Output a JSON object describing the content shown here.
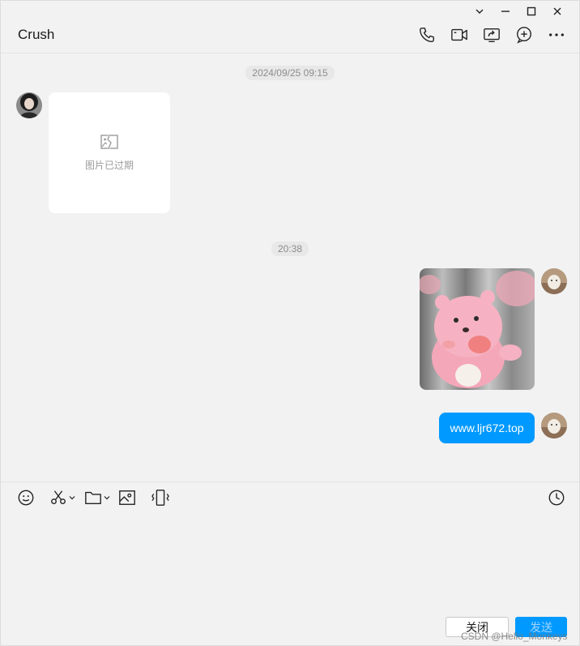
{
  "header": {
    "title": "Crush",
    "actions": [
      "phone-icon",
      "video-call-icon",
      "screen-share-icon",
      "add-member-icon",
      "more-icon"
    ]
  },
  "window_controls": [
    "chevron-down-icon",
    "minimize-icon",
    "maximize-icon",
    "close-icon"
  ],
  "messages": {
    "timestamp_1": "2024/09/25 09:15",
    "expired_image_text": "图片已过期",
    "timestamp_2": "20:38",
    "link_text": "www.ljr672.top"
  },
  "toolbar": [
    "emoji-icon",
    "scissors-icon",
    "folder-icon",
    "image-icon",
    "vibrate-icon",
    "clock-icon"
  ],
  "footer": {
    "close_label": "关闭",
    "send_label": "发送",
    "watermark": "CSDN @Hello_Monkeys"
  },
  "colors": {
    "accent": "#0099ff",
    "background": "#f2f2f2",
    "bubble_text": "#ffffff"
  }
}
